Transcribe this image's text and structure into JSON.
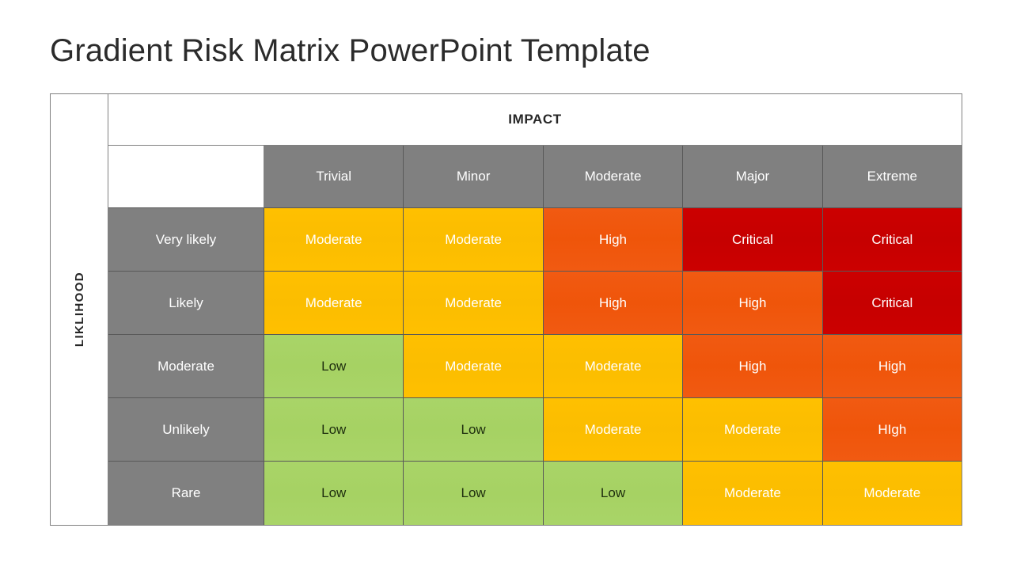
{
  "slide": {
    "title": "Gradient Risk Matrix PowerPoint Template"
  },
  "matrix": {
    "impact_axis_label": "IMPACT",
    "likelihood_axis_label": "LIKLIHOOD",
    "impact_levels": [
      "Trivial",
      "Minor",
      "Moderate",
      "Major",
      "Extreme"
    ],
    "likelihood_levels": [
      "Very likely",
      "Likely",
      "Moderate",
      "Unlikely",
      "Rare"
    ],
    "colors": {
      "low": "#a9d468",
      "moderate": "#ffc000",
      "high": "#f15a12",
      "critical": "#cc0000",
      "header_gray": "#808080",
      "title_text": "#2b2b2b",
      "axis_text": "#262626"
    },
    "rows": [
      {
        "likelihood": "Very likely",
        "cells": [
          {
            "label": "Moderate",
            "level": "moderate"
          },
          {
            "label": "Moderate",
            "level": "moderate"
          },
          {
            "label": "High",
            "level": "high"
          },
          {
            "label": "Critical",
            "level": "critical"
          },
          {
            "label": "Critical",
            "level": "critical"
          }
        ]
      },
      {
        "likelihood": "Likely",
        "cells": [
          {
            "label": "Moderate",
            "level": "moderate"
          },
          {
            "label": "Moderate",
            "level": "moderate"
          },
          {
            "label": "High",
            "level": "high"
          },
          {
            "label": "High",
            "level": "high"
          },
          {
            "label": "Critical",
            "level": "critical"
          }
        ]
      },
      {
        "likelihood": "Moderate",
        "cells": [
          {
            "label": "Low",
            "level": "low"
          },
          {
            "label": "Moderate",
            "level": "moderate"
          },
          {
            "label": "Moderate",
            "level": "moderate"
          },
          {
            "label": "High",
            "level": "high"
          },
          {
            "label": "High",
            "level": "high"
          }
        ]
      },
      {
        "likelihood": "Unlikely",
        "cells": [
          {
            "label": "Low",
            "level": "low"
          },
          {
            "label": "Low",
            "level": "low"
          },
          {
            "label": "Moderate",
            "level": "moderate"
          },
          {
            "label": "Moderate",
            "level": "moderate"
          },
          {
            "label": "HIgh",
            "level": "high"
          }
        ]
      },
      {
        "likelihood": "Rare",
        "cells": [
          {
            "label": "Low",
            "level": "low"
          },
          {
            "label": "Low",
            "level": "low"
          },
          {
            "label": "Low",
            "level": "low"
          },
          {
            "label": "Moderate",
            "level": "moderate"
          },
          {
            "label": "Moderate",
            "level": "moderate"
          }
        ]
      }
    ]
  }
}
